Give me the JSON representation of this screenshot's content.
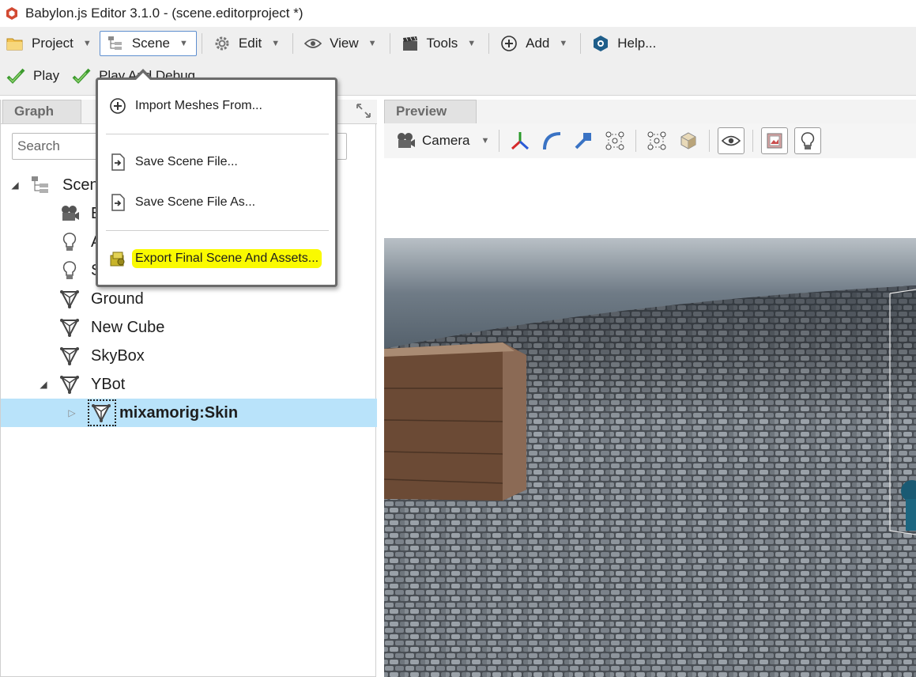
{
  "window": {
    "title": "Babylon.js Editor 3.1.0 - (scene.editorproject *)"
  },
  "menubar": {
    "items": [
      {
        "label": "Project",
        "icon": "folder-icon"
      },
      {
        "label": "Scene",
        "icon": "scene-tree-icon"
      },
      {
        "label": "Edit",
        "icon": "gear-icon"
      },
      {
        "label": "View",
        "icon": "eye-icon"
      },
      {
        "label": "Tools",
        "icon": "clapperboard-icon"
      },
      {
        "label": "Add",
        "icon": "plus-circle-icon"
      },
      {
        "label": "Help...",
        "icon": "help-icon"
      }
    ],
    "active": "Scene"
  },
  "playbar": {
    "play_label": "Play",
    "play_debug_label": "Play And Debug"
  },
  "graph": {
    "tab_label": "Graph",
    "search_placeholder": "Search",
    "tree": [
      {
        "label": "Scene",
        "partial": "Scen",
        "icon": "scene-tree-icon",
        "expanded": true
      },
      {
        "label": "",
        "partial": "E",
        "icon": "camera-icon"
      },
      {
        "label": "",
        "partial": "A",
        "icon": "lightbulb-icon"
      },
      {
        "label": "",
        "partial": "S",
        "icon": "lightbulb-icon"
      },
      {
        "label": "Ground",
        "icon": "mesh-icon"
      },
      {
        "label": "New Cube",
        "icon": "mesh-icon"
      },
      {
        "label": "SkyBox",
        "icon": "mesh-icon"
      },
      {
        "label": "YBot",
        "icon": "mesh-icon",
        "expanded": true
      },
      {
        "label": "mixamorig:Skin",
        "icon": "mesh-icon",
        "selected": true,
        "collapsed": true
      }
    ]
  },
  "scene_menu": {
    "items": [
      {
        "label": "Import Meshes From...",
        "icon": "plus-circle-icon"
      },
      {
        "label": "Save Scene File...",
        "icon": "save-file-icon"
      },
      {
        "label": "Save Scene File As...",
        "icon": "save-file-icon"
      },
      {
        "label": "Export Final Scene And Assets...",
        "icon": "export-icon",
        "highlighted": true
      }
    ]
  },
  "preview": {
    "tab_label": "Preview",
    "camera_label": "Camera",
    "tools": [
      "gizmo-axes-icon",
      "rotate-gizmo-icon",
      "scale-gizmo-icon",
      "bounding-box-icon",
      "bounding-box-icon",
      "cube-icon",
      "eye-icon",
      "texture-icon",
      "lightbulb-icon"
    ]
  },
  "colors": {
    "selection": "#b9e3fa",
    "highlight": "#fafa00",
    "accent": "#3a6fc4"
  }
}
